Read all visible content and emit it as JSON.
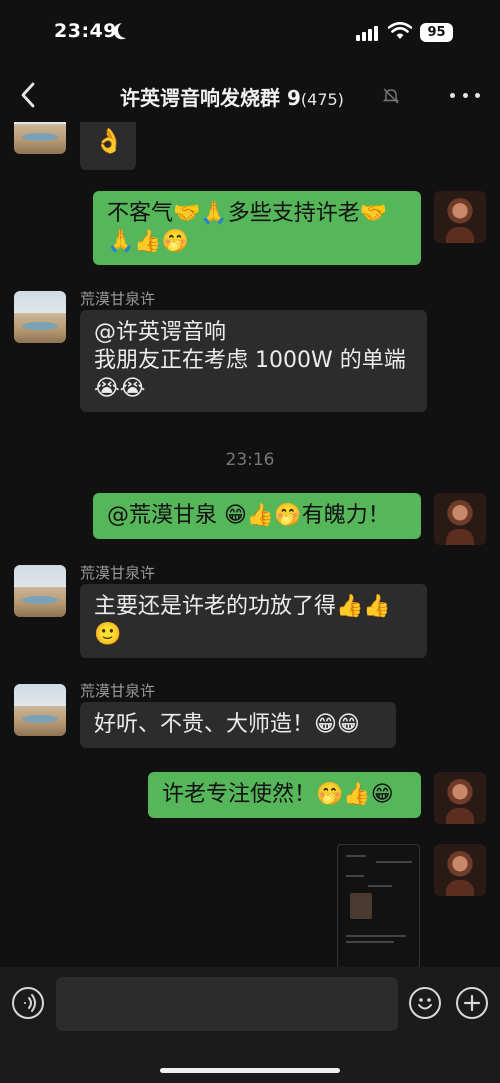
{
  "status_bar": {
    "time": "23:49",
    "battery": "95"
  },
  "nav": {
    "title": "许英谔音响发烧群 9",
    "member_count": "(475)"
  },
  "messages": [
    {
      "sender": "",
      "text": "👌"
    },
    {
      "sender": "",
      "text": "不客气🤝🙏多些支持许老🤝🙏👍🤭"
    },
    {
      "sender": "荒漠甘泉许",
      "text": "@许英谔音响\n我朋友正在考虑 1000W 的单端😭😭"
    },
    {
      "sender": "",
      "text": "@荒漠甘泉 😁👍🤭有魄力！"
    },
    {
      "sender": "荒漠甘泉许",
      "text": "主要还是许老的功放了得👍👍🙂"
    },
    {
      "sender": "荒漠甘泉许",
      "text": "好听、不贵、大师造！😁😁"
    },
    {
      "sender": "",
      "text": "许老专注使然！🤭👍😁"
    }
  ],
  "time_separator": "23:16",
  "input": {
    "value": ""
  }
}
